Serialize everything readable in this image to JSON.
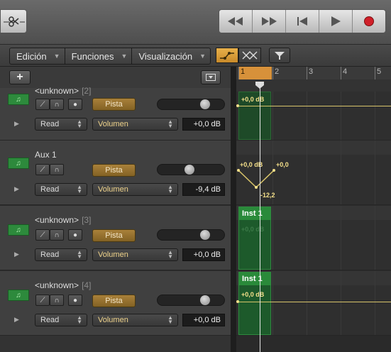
{
  "menus": [
    "Edición",
    "Funciones",
    "Visualización"
  ],
  "ruler": {
    "bars": [
      "1",
      "2",
      "3",
      "4",
      "5"
    ]
  },
  "tracks": [
    {
      "name": "<unknown>",
      "number": "[2]",
      "pista": "Pista",
      "read": "Read",
      "param": "Volumen",
      "value": "+0,0 dB",
      "fader": 0.75
    },
    {
      "name": "Aux 1",
      "number": "",
      "pista": "Pista",
      "read": "Read",
      "param": "Volumen",
      "value": "-9,4 dB",
      "fader": 0.48
    },
    {
      "name": "<unknown>",
      "number": "[3]",
      "pista": "Pista",
      "read": "Read",
      "param": "Volumen",
      "value": "+0,0 dB",
      "fader": 0.75
    },
    {
      "name": "<unknown>",
      "number": "[4]",
      "pista": "Pista",
      "read": "Read",
      "param": "Volumen",
      "value": "+0,0 dB",
      "fader": 0.75
    }
  ],
  "lanes": {
    "lane1": {
      "label": "+0,0 dB"
    },
    "lane2": {
      "left": "+0,0 dB",
      "right": "+0,0",
      "low": "-12,2"
    },
    "lane3": {
      "region": "Inst 1",
      "label": "+0,0 dB"
    },
    "lane4": {
      "region": "Inst 1",
      "label": "+0,0 dB"
    }
  },
  "colors": {
    "pista": "#a9813a",
    "region": "#2a8a3a",
    "automation": "#f5e08a",
    "record": "#d0202a"
  }
}
